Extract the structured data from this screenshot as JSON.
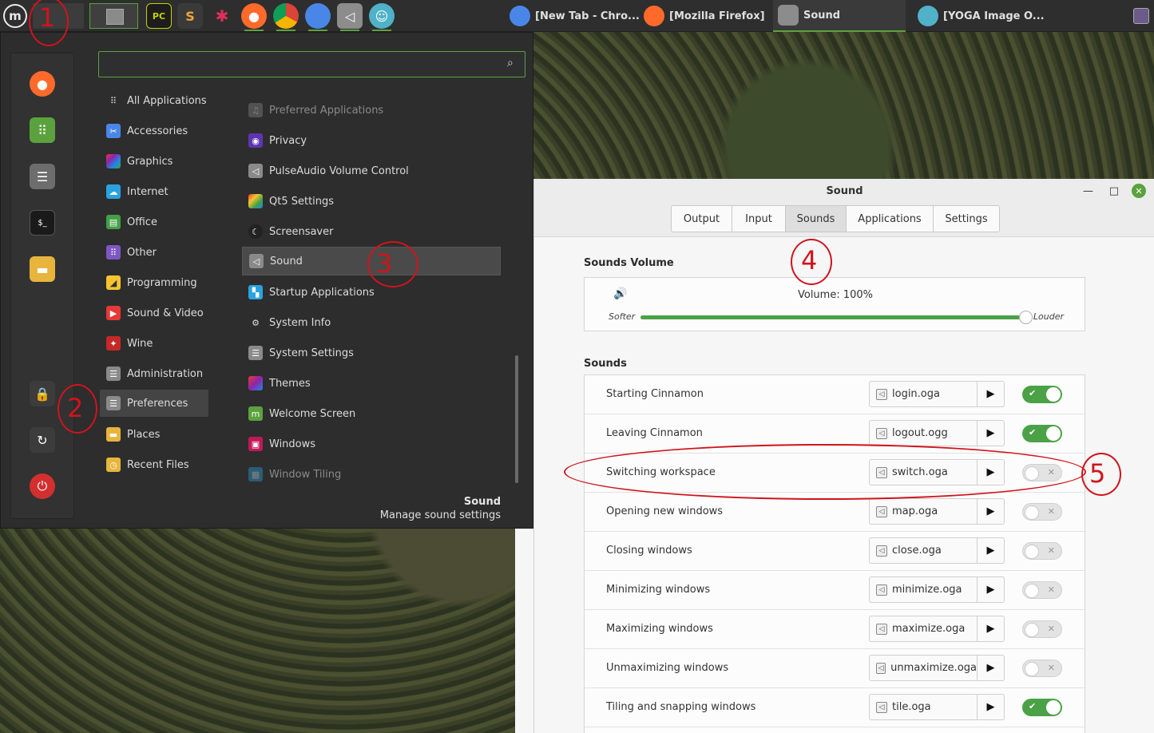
{
  "panel": {
    "menu_logo": "m",
    "tasks": [
      {
        "label": "[New Tab - Chro...",
        "color": "#4a86e8"
      },
      {
        "label": "[Mozilla Firefox]",
        "color": "#ff6a2a"
      },
      {
        "label": "Sound",
        "color": "#8c8c8c"
      },
      {
        "label": "[YOGA Image O...",
        "color": "#4fb2c8"
      }
    ]
  },
  "menu": {
    "search_placeholder": "",
    "categories": [
      {
        "label": "All Applications"
      },
      {
        "label": "Accessories"
      },
      {
        "label": "Graphics"
      },
      {
        "label": "Internet"
      },
      {
        "label": "Office"
      },
      {
        "label": "Other"
      },
      {
        "label": "Programming"
      },
      {
        "label": "Sound & Video"
      },
      {
        "label": "Wine"
      },
      {
        "label": "Administration"
      },
      {
        "label": "Preferences"
      },
      {
        "label": "Places"
      },
      {
        "label": "Recent Files"
      }
    ],
    "apps": [
      {
        "label": "Preferred Applications"
      },
      {
        "label": "Privacy"
      },
      {
        "label": "PulseAudio Volume Control"
      },
      {
        "label": "Qt5 Settings"
      },
      {
        "label": "Screensaver"
      },
      {
        "label": "Sound"
      },
      {
        "label": "Startup Applications"
      },
      {
        "label": "System Info"
      },
      {
        "label": "System Settings"
      },
      {
        "label": "Themes"
      },
      {
        "label": "Welcome Screen"
      },
      {
        "label": "Windows"
      },
      {
        "label": "Window Tiling"
      }
    ],
    "description_title": "Sound",
    "description_sub": "Manage sound settings"
  },
  "sound_window": {
    "title": "Sound",
    "tabs": [
      "Output",
      "Input",
      "Sounds",
      "Applications",
      "Settings"
    ],
    "volume_section": "Sounds Volume",
    "volume_text": "Volume: 100%",
    "volume_percent": 100,
    "softer": "Softer",
    "louder": "Louder",
    "sounds_section": "Sounds",
    "rows": [
      {
        "label": "Starting Cinnamon",
        "file": "login.oga",
        "enabled": true
      },
      {
        "label": "Leaving Cinnamon",
        "file": "logout.ogg",
        "enabled": true
      },
      {
        "label": "Switching workspace",
        "file": "switch.oga",
        "enabled": false
      },
      {
        "label": "Opening new windows",
        "file": "map.oga",
        "enabled": false
      },
      {
        "label": "Closing windows",
        "file": "close.oga",
        "enabled": false
      },
      {
        "label": "Minimizing windows",
        "file": "minimize.oga",
        "enabled": false
      },
      {
        "label": "Maximizing windows",
        "file": "maximize.oga",
        "enabled": false
      },
      {
        "label": "Unmaximizing windows",
        "file": "unmaximize.oga",
        "enabled": false
      },
      {
        "label": "Tiling and snapping windows",
        "file": "tile.oga",
        "enabled": true
      }
    ]
  },
  "annotations": [
    "1",
    "2",
    "3",
    "4",
    "5"
  ],
  "colors": {
    "accent": "#5ba23e",
    "annotation": "#d0141b"
  }
}
